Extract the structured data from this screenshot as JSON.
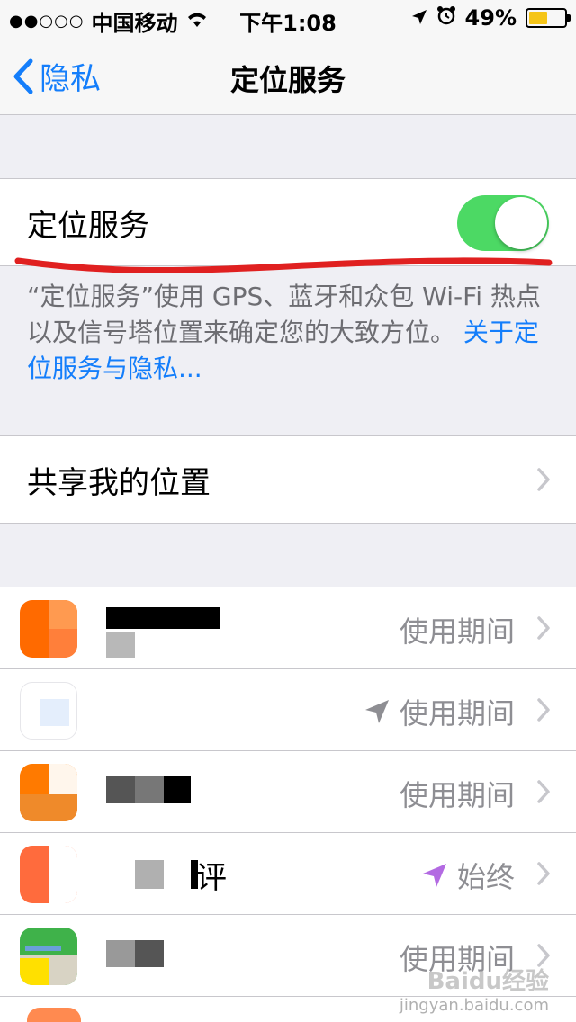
{
  "status_bar": {
    "signal": "●●○○○",
    "carrier": "中国移动",
    "time": "下午1:08",
    "battery_percent": "49%"
  },
  "nav": {
    "back_label": "隐私",
    "title": "定位服务"
  },
  "location_services": {
    "label": "定位服务",
    "toggle_on": true
  },
  "footer": {
    "description": "“定位服务”使用 GPS、蓝牙和众包 Wi-Fi 热点以及信号塔位置来确定您的大致方位。",
    "link": "关于定位服务与隐私..."
  },
  "share_location": {
    "label": "共享我的位置"
  },
  "apps": [
    {
      "name": "",
      "status": "使用期间",
      "arrow": false
    },
    {
      "name": "",
      "status": "使用期间",
      "arrow": true
    },
    {
      "name": "",
      "status": "使用期间",
      "arrow": false
    },
    {
      "name": "评",
      "status": "始终",
      "arrow": true
    },
    {
      "name": "",
      "status": "使用期间",
      "arrow": false
    }
  ],
  "colors": {
    "accent": "#147efb",
    "toggle_on": "#4cd964",
    "location_arrow_always": "#b36ae2",
    "location_arrow_recent": "#8e8e93"
  },
  "watermark": {
    "line1": "Baidu经验",
    "line2": "jingyan.baidu.com"
  }
}
